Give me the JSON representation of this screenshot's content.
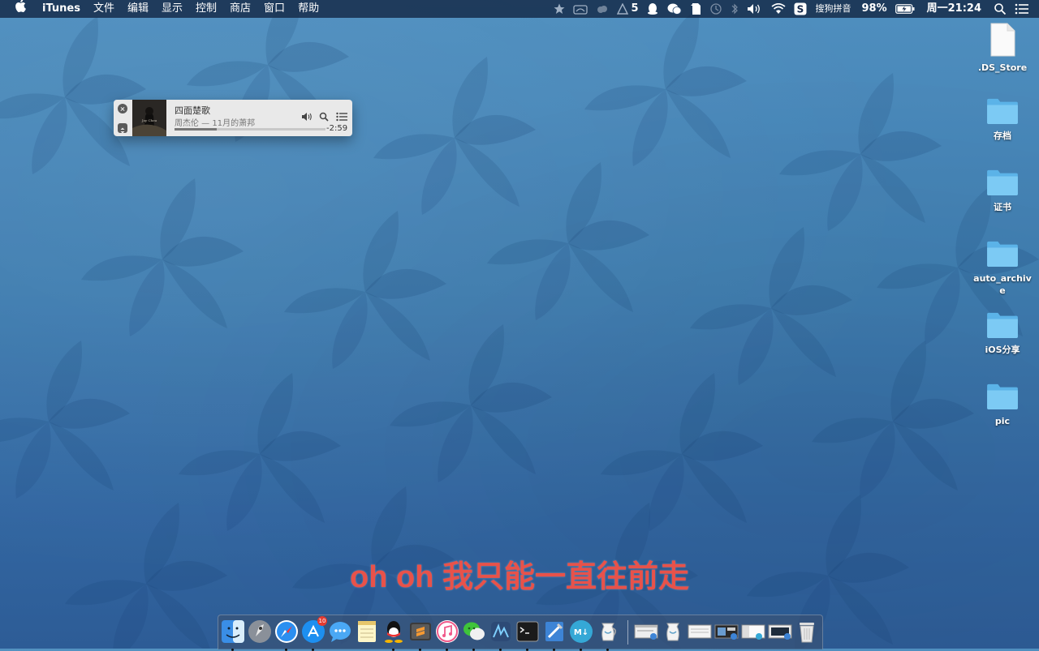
{
  "menubar": {
    "app_name": "iTunes",
    "menus": [
      "文件",
      "编辑",
      "显示",
      "控制",
      "商店",
      "窗口",
      "帮助"
    ],
    "status": {
      "badge_count": "5",
      "input_method": "搜狗拼音",
      "battery_percent": "98%",
      "clock": "周一21:24"
    }
  },
  "miniplayer": {
    "song_title": "四面楚歌",
    "subtitle": "周杰伦 — 11月的萧邦",
    "remaining_time": "-2:59",
    "progress_fraction": 0.28
  },
  "desktop_icons": [
    {
      "label": ".DS_Store",
      "kind": "file"
    },
    {
      "label": "存档",
      "kind": "folder"
    },
    {
      "label": "证书",
      "kind": "folder"
    },
    {
      "label": "auto_archive",
      "kind": "folder"
    },
    {
      "label": "iOS分享",
      "kind": "folder"
    },
    {
      "label": "pic",
      "kind": "folder"
    }
  ],
  "lyric": "oh oh 我只能一直往前走",
  "dock": {
    "app_store_badge": "10",
    "apps": [
      "finder",
      "launchpad",
      "safari",
      "app-store",
      "messages",
      "notes",
      "qq",
      "sublime-text",
      "itunes",
      "wechat",
      "xcode-instruments",
      "terminal",
      "xcode",
      "markdown",
      "pitcher"
    ]
  },
  "colors": {
    "lyric": "#e8524a",
    "folder": "#6ec3f0",
    "menubar": "#14284a"
  }
}
